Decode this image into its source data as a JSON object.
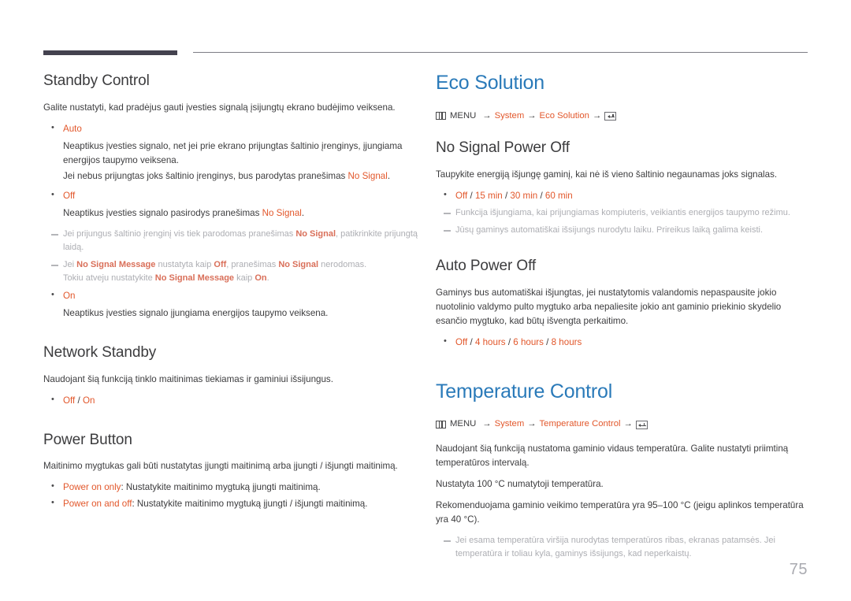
{
  "page": {
    "number": "75"
  },
  "icons": {
    "menu": "menu-grid-icon",
    "enter": "enter-key-icon"
  },
  "colors": {
    "accent_blue": "#2a7ab9",
    "accent_orange": "#e2572b",
    "note_gray": "#adaeb3",
    "rule_dark": "#44424f",
    "body_text": "#3c3c3e"
  },
  "left_column": {
    "sections": [
      {
        "heading": "Standby Control",
        "intro": "Galite nustatyti, kad pradėjus gauti įvesties signalą įsijungtų ekrano budėjimo veiksena.",
        "items": [
          {
            "label": "Auto",
            "lines": [
              "Neaptikus įvesties signalo, net jei prie ekrano prijungtas šaltinio įrenginys, įjungiama energijos taupymo veiksena.",
              "Jei nebus prijungtas joks šaltinio įrenginys, bus parodytas pranešimas "
            ],
            "line2_tail": "No Signal",
            "line2_end": "."
          },
          {
            "label": "Off",
            "sub_pre": "Neaptikus įvesties signalo pasirodys pranešimas ",
            "sub_hl": "No Signal",
            "sub_post": "."
          },
          {
            "label": "On",
            "sub_pre": "Neaptikus įvesties signalo įjungiama energijos taupymo veiksena."
          }
        ],
        "notes": [
          {
            "p1": "Jei prijungus šaltinio įrenginį vis tiek parodomas pranešimas ",
            "hl1": "No Signal",
            "p2": ", patikrinkite prijungtą laidą."
          },
          {
            "p1": "Jei ",
            "hl1": "No Signal Message",
            "p2": " nustatyta kaip ",
            "hl2": "Off",
            "p3": ", pranešimas ",
            "hl3": "No Signal",
            "p4": " nerodomas.",
            "line2_p1": "Tokiu atveju nustatykite ",
            "line2_hl1": "No Signal Message",
            "line2_p2": " kaip ",
            "line2_hl2": "On",
            "line2_p3": "."
          }
        ]
      },
      {
        "heading": "Network Standby",
        "intro": "Naudojant šią funkciją tinklo maitinimas tiekiamas ir gaminiui išsijungus.",
        "option_line": {
          "parts": [
            "Off",
            "On"
          ],
          "separator": " / "
        }
      },
      {
        "heading": "Power Button",
        "intro": "Maitinimo mygtukas gali būti nustatytas įjungti maitinimą arba įjungti / išjungti maitinimą.",
        "labeled_items": [
          {
            "label": "Power on only",
            "text": ": Nustatykite maitinimo mygtuką įjungti maitinimą."
          },
          {
            "label": "Power on and off",
            "text": ": Nustatykite maitinimo mygtuką įjungti / išjungti maitinimą."
          }
        ]
      }
    ]
  },
  "right_column": {
    "chapters": [
      {
        "title": "Eco Solution",
        "breadcrumb": {
          "menu_label": "MENU",
          "arrow": "→",
          "items": [
            "System",
            "Eco Solution"
          ]
        },
        "sections": [
          {
            "heading": "No Signal Power Off",
            "intro": "Taupykite energiją išjungę gaminį, kai nė iš vieno šaltinio negaunamas joks signalas.",
            "option_line": {
              "parts": [
                "Off",
                "15 min",
                "30 min",
                "60 min"
              ],
              "separator": " / "
            },
            "notes": [
              "Funkcija išjungiama, kai prijungiamas kompiuteris, veikiantis energijos taupymo režimu.",
              "Jūsų gaminys automatiškai išsijungs nurodytu laiku. Prireikus laiką galima keisti."
            ]
          },
          {
            "heading": "Auto Power Off",
            "intro": "Gaminys bus automatiškai išjungtas, jei nustatytomis valandomis nepaspausite jokio nuotolinio valdymo pulto mygtuko arba nepaliesite jokio ant gaminio priekinio skydelio esančio mygtuko, kad būtų išvengta perkaitimo.",
            "option_line": {
              "parts": [
                "Off",
                "4 hours",
                "6 hours",
                "8 hours"
              ],
              "separator": " / "
            }
          }
        ]
      },
      {
        "title": "Temperature Control",
        "breadcrumb": {
          "menu_label": "MENU",
          "arrow": "→",
          "items": [
            "System",
            "Temperature Control"
          ]
        },
        "paragraphs": [
          "Naudojant šią funkciją nustatoma gaminio vidaus temperatūra. Galite nustatyti priimtiną temperatūros intervalą.",
          "Nustatyta 100 °C numatytoji temperatūra.",
          "Rekomenduojama gaminio veikimo temperatūra yra 95–100 °C (jeigu aplinkos temperatūra yra 40 °C)."
        ],
        "notes": [
          "Jei esama temperatūra viršija nurodytas temperatūros ribas, ekranas patamsės. Jei temperatūra ir toliau kyla, gaminys išsijungs, kad neperkaistų."
        ]
      }
    ]
  }
}
